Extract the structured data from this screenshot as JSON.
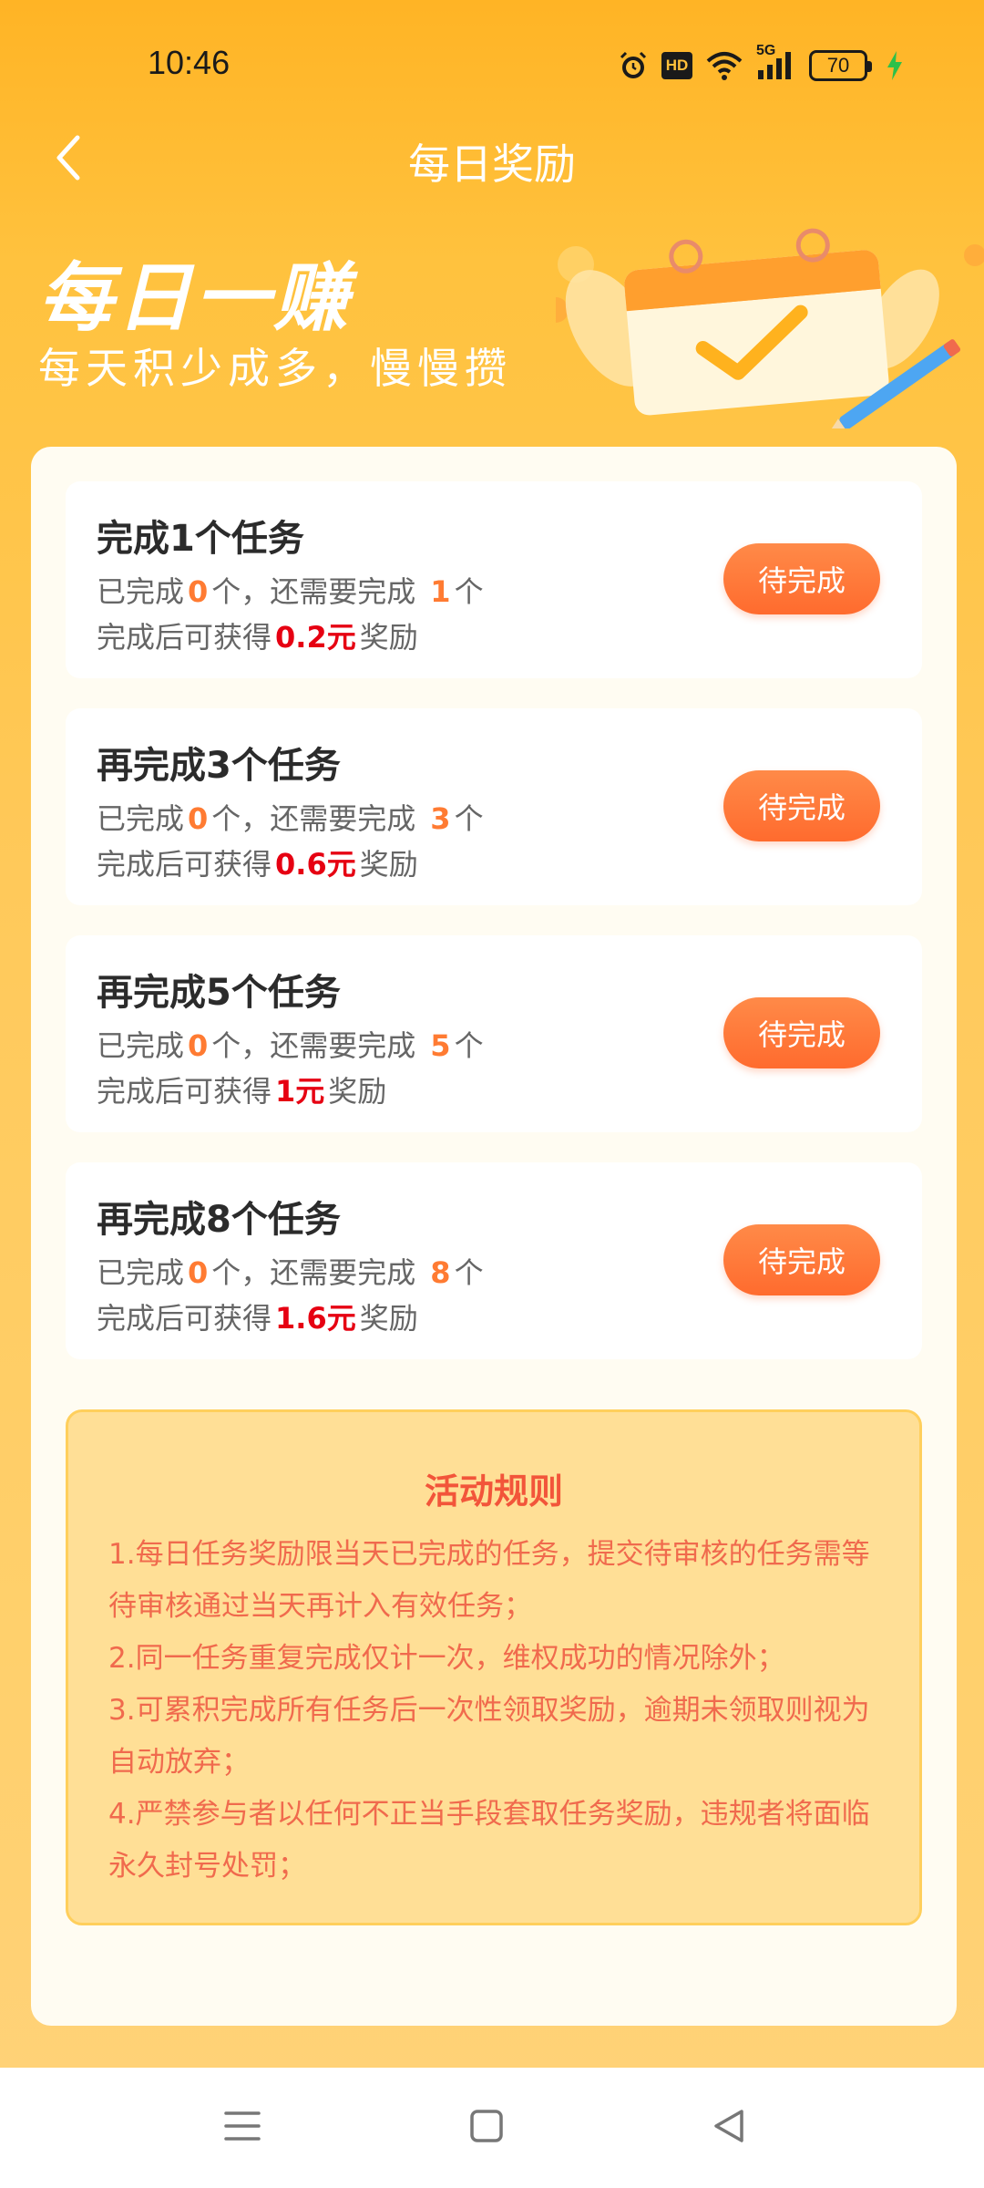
{
  "status_bar": {
    "time": "10:46",
    "hd_label": "HD",
    "network_label": "5G",
    "battery_level": "70",
    "icons": [
      "alarm-icon",
      "hd-icon",
      "wifi-icon",
      "5g-signal-icon",
      "battery-icon",
      "charging-icon"
    ]
  },
  "header": {
    "title": "每日奖励",
    "back_icon": "chevron-left-icon"
  },
  "banner": {
    "title": "每日一赚",
    "subtitle": "每天积少成多，慢慢攒",
    "art_icon": "calendar-check-icon"
  },
  "colors": {
    "background": "#FFC03A",
    "accent_orange": "#FF7B32",
    "reward_red": "#E60012",
    "button": "#FF6B2E",
    "rules_text": "#F06A4D"
  },
  "tasks": [
    {
      "title": "完成1个任务",
      "done_prefix": "已完成",
      "done_count": "0",
      "done_mid": "个，还需要完成",
      "remaining": "1",
      "remaining_suffix": "个",
      "reward_prefix": "完成后可获得",
      "reward": "0.2元",
      "reward_suffix": "奖励",
      "button_label": "待完成"
    },
    {
      "title": "再完成3个任务",
      "done_prefix": "已完成",
      "done_count": "0",
      "done_mid": "个，还需要完成",
      "remaining": "3",
      "remaining_suffix": "个",
      "reward_prefix": "完成后可获得",
      "reward": "0.6元",
      "reward_suffix": "奖励",
      "button_label": "待完成"
    },
    {
      "title": "再完成5个任务",
      "done_prefix": "已完成",
      "done_count": "0",
      "done_mid": "个，还需要完成",
      "remaining": "5",
      "remaining_suffix": "个",
      "reward_prefix": "完成后可获得",
      "reward": "1元",
      "reward_suffix": "奖励",
      "button_label": "待完成"
    },
    {
      "title": "再完成8个任务",
      "done_prefix": "已完成",
      "done_count": "0",
      "done_mid": "个，还需要完成",
      "remaining": "8",
      "remaining_suffix": "个",
      "reward_prefix": "完成后可获得",
      "reward": "1.6元",
      "reward_suffix": "奖励",
      "button_label": "待完成"
    }
  ],
  "rules": {
    "title": "活动规则",
    "items": [
      "1.每日任务奖励限当天已完成的任务，提交待审核的任务需等待审核通过当天再计入有效任务；",
      "2.同一任务重复完成仅计一次，维权成功的情况除外；",
      "3.可累积完成所有任务后一次性领取奖励，逾期未领取则视为自动放弃；",
      "4.严禁参与者以任何不正当手段套取任务奖励，违规者将面临永久封号处罚；"
    ]
  },
  "nav_bar": {
    "icons": [
      "menu-icon",
      "home-square-icon",
      "back-triangle-icon"
    ]
  }
}
